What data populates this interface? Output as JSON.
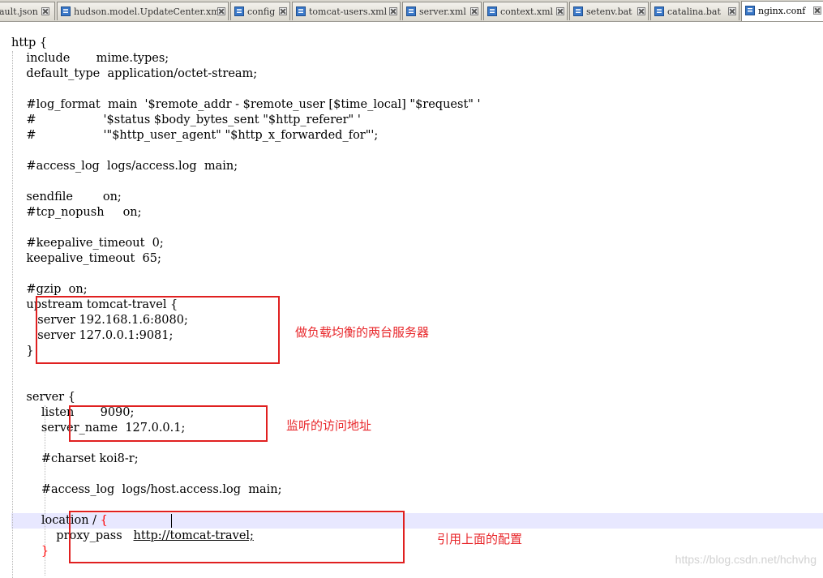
{
  "tabs": [
    {
      "label": "ault.json"
    },
    {
      "label": "hudson.model.UpdateCenter.xml"
    },
    {
      "label": "config"
    },
    {
      "label": "tomcat-users.xml"
    },
    {
      "label": "server.xml"
    },
    {
      "label": "context.xml"
    },
    {
      "label": "setenv.bat"
    },
    {
      "label": "catalina.bat"
    },
    {
      "label": "nginx.conf"
    }
  ],
  "code": {
    "l0": "http {",
    "l1": "    include       mime.types;",
    "l2": "    default_type  application/octet-stream;",
    "l3": "",
    "l4": "    #log_format  main  '$remote_addr - $remote_user [$time_local] \"$request\" '",
    "l5": "    #                  '$status $body_bytes_sent \"$http_referer\" '",
    "l6": "    #                  '\"$http_user_agent\" \"$http_x_forwarded_for\"';",
    "l7": "",
    "l8": "    #access_log  logs/access.log  main;",
    "l9": "",
    "l10": "    sendfile        on;",
    "l11": "    #tcp_nopush     on;",
    "l12": "",
    "l13": "    #keepalive_timeout  0;",
    "l14": "    keepalive_timeout  65;",
    "l15": "",
    "l16": "    #gzip  on;",
    "l17": "    upstream tomcat-travel {",
    "l18": "       server 192.168.1.6:8080;",
    "l19": "       server 127.0.0.1:9081;",
    "l20": "    }",
    "l21": "",
    "l22": "",
    "l23": "    server {",
    "l24": "        listen       9090;",
    "l25": "        server_name  127.0.0.1;",
    "l26": "",
    "l27": "        #charset koi8-r;",
    "l28": "",
    "l29": "        #access_log  logs/host.access.log  main;",
    "l30": "",
    "l31_pre": "        location / ",
    "l31_brace": "{",
    "l32_pre": "            proxy_pass   ",
    "l32_url": "http://tomcat-travel;",
    "l33": "        }"
  },
  "annotations": {
    "upstream_note": "做负载均衡的两台服务器",
    "listen_note": "监听的访问地址",
    "location_note": "引用上面的配置"
  },
  "watermark": "https://blog.csdn.net/hchvhg",
  "colors": {
    "annotation_red": "#e02020",
    "current_line": "#e8e8ff",
    "active_tab": "#ffffff"
  }
}
